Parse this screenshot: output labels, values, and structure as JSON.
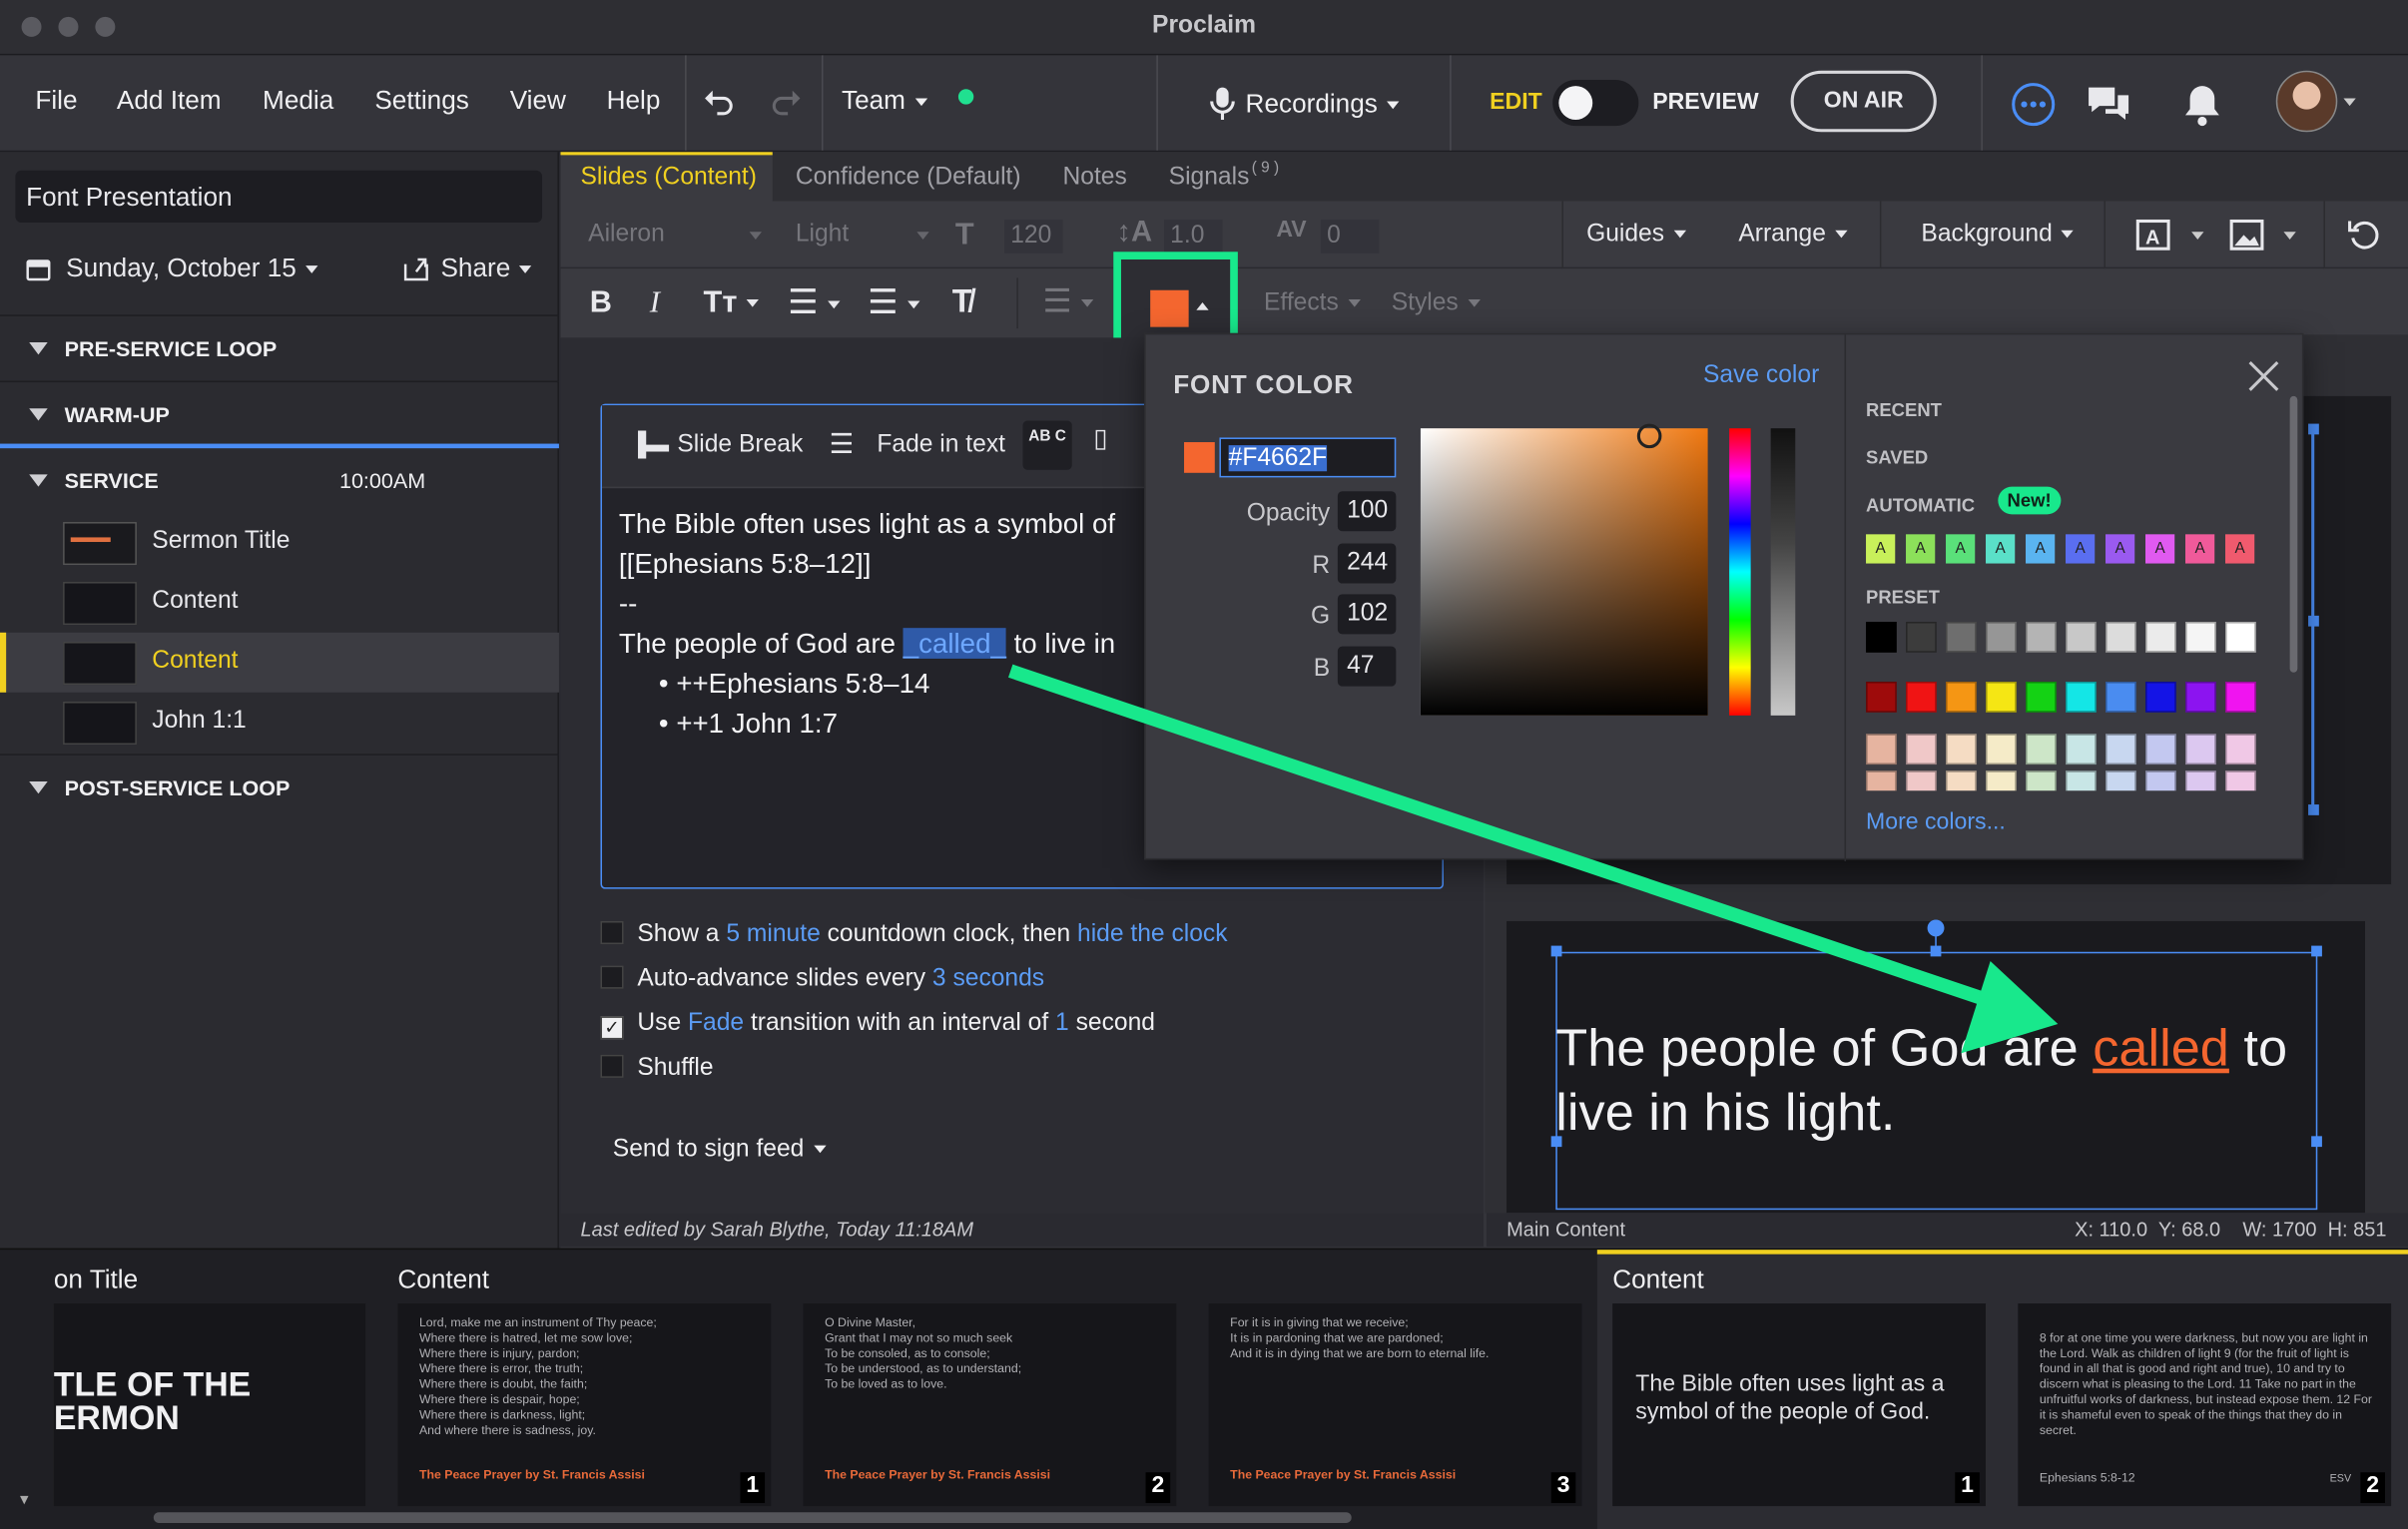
{
  "window": {
    "title": "Proclaim"
  },
  "menu": {
    "file": "File",
    "add_item": "Add Item",
    "media": "Media",
    "settings": "Settings",
    "view": "View",
    "help": "Help",
    "team": "Team",
    "recordings": "Recordings",
    "edit": "EDIT",
    "preview": "PREVIEW",
    "on_air": "ON AIR"
  },
  "sidebar": {
    "presentation_name": "Font Presentation",
    "date": "Sunday, October 15",
    "share": "Share",
    "sections": {
      "pre": "PRE-SERVICE LOOP",
      "warm": "WARM-UP",
      "service": "SERVICE",
      "service_time": "10:00AM",
      "post": "POST-SERVICE LOOP"
    },
    "items": [
      "Sermon Title",
      "Content",
      "Content",
      "John 1:1"
    ]
  },
  "tabs": [
    "Slides (Content)",
    "Confidence (Default)",
    "Notes",
    "Signals"
  ],
  "signals_badge": "( 9 )",
  "toolbar": {
    "font": "Aileron",
    "weight": "Light",
    "size": "120",
    "line_height": "1.0",
    "spacing": "0",
    "guides": "Guides",
    "arrange": "Arrange",
    "background": "Background",
    "effects": "Effects",
    "styles": "Styles"
  },
  "editor": {
    "slide_break": "Slide Break",
    "fade_in": "Fade in text",
    "abc": "AB C",
    "line1": "The Bible often uses light as a symbol of",
    "line2": "[[Ephesians 5:8–12]]",
    "line3": "--",
    "line4a": "The people of God are",
    "line4b": "_called_",
    "line4c": "to live in",
    "bullet1": "++Ephesians 5:8–14",
    "bullet2": "++1 John 1:7"
  },
  "options": {
    "o1a": "Show a",
    "o1b": "5 minute",
    "o1c": "countdown clock, then",
    "o1d": "hide the clock",
    "o2a": "Auto-advance slides every",
    "o2b": "3 seconds",
    "o3a": "Use",
    "o3b": "Fade",
    "o3c": "transition with an interval of",
    "o3d": "1",
    "o3e": "second",
    "o4": "Shuffle",
    "send": "Send to sign feed"
  },
  "color_picker": {
    "title": "FONT COLOR",
    "save": "Save color",
    "hex": "#F4662F",
    "opacity_label": "Opacity",
    "opacity": "100",
    "r_label": "R",
    "r": "244",
    "g_label": "G",
    "g": "102",
    "b_label": "B",
    "b": "47",
    "recent": "RECENT",
    "saved": "SAVED",
    "automatic": "AUTOMATIC",
    "new_badge": "New!",
    "preset": "PRESET",
    "more": "More colors...",
    "swatch_letter": "A",
    "auto_colors": [
      "#c8f05a",
      "#8ce05a",
      "#5ae07a",
      "#5ae0c8",
      "#5ab4f0",
      "#5a6ef0",
      "#9a5af0",
      "#e05af0",
      "#f05a9a",
      "#f05a6e"
    ],
    "preset_row1": [
      "#000000",
      "#3c3c3c",
      "#6e6e6e",
      "#969696",
      "#b4b4b4",
      "#c8c8c8",
      "#dcdcdc",
      "#ebebeb",
      "#f5f5f5",
      "#ffffff"
    ],
    "preset_row2": [
      "#9e0b0b",
      "#f01414",
      "#f59614",
      "#f5e614",
      "#14d214",
      "#14e6e6",
      "#4a8cf0",
      "#1414e6",
      "#8c14f0",
      "#f014f0"
    ],
    "preset_row3": [
      "#e6b4a0",
      "#f0c8c8",
      "#f5dcc3",
      "#f5ebc8",
      "#cde6c8",
      "#c8e6e6",
      "#c8d7f0",
      "#c3c8f0",
      "#dcc8f0",
      "#f0c8e6"
    ],
    "accent": "#F4662F"
  },
  "preview": {
    "text_a": "The people of God are",
    "text_b": "called",
    "text_c": "to",
    "text_d": "live in his light."
  },
  "status": {
    "last_edited": "Last edited by Sarah Blythe, Today 11:18AM",
    "layer": "Main Content",
    "coords": "X: 110.0  Y: 68.0    W: 1700  H: 851"
  },
  "filmstrip": {
    "label1": "on Title",
    "label2": "Content",
    "label3": "Content",
    "thumb1": "TLE OF THE\nERMON",
    "thumb2": "Lord, make me an instrument of Thy peace;\nWhere there is hatred, let me sow love;\nWhere there is injury, pardon;\nWhere there is error, the truth;\nWhere there is doubt, the faith;\nWhere there is despair, hope;\nWhere there is darkness, light;\nAnd where there is sadness, joy.",
    "thumb3": "O Divine Master,\nGrant that I may not so much seek\nTo be consoled, as to console;\nTo be understood, as to understand;\nTo be loved as to love.",
    "thumb4": "For it is in giving that we receive;\nIt is in pardoning that we are pardoned;\nAnd it is in dying that we are born to eternal life.",
    "prayer": "The Peace Prayer by St. Francis Assisi",
    "thumb5": "The Bible often uses light as a\nsymbol of the people of God.",
    "thumb6": "8 for at one time you were darkness, but now you are light in\nthe Lord. Walk as children of light 9 (for the fruit of light is\nfound in all that is good and right and true), 10 and try to\ndiscern what is pleasing to the Lord. 11 Take no part in the\nunfruitful works of darkness, but instead expose them. 12 For\nit is shameful even to speak of the things that they do in\nsecret.",
    "thumb6_ref": "Ephesians 5:8-12",
    "thumb6_ver": "ESV",
    "nums": [
      "1",
      "2",
      "3",
      "1",
      "2"
    ]
  }
}
